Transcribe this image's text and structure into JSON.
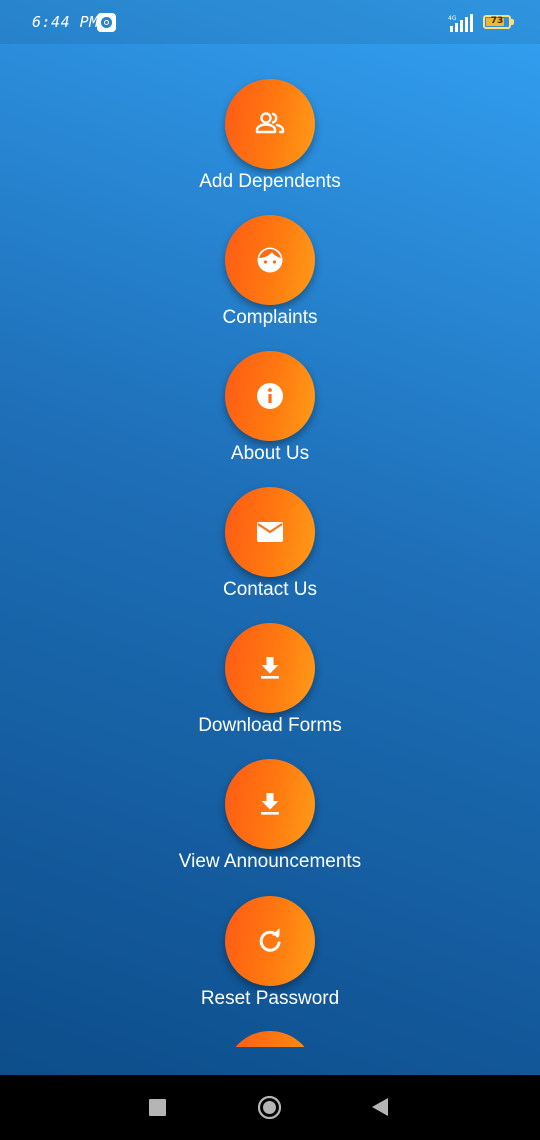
{
  "status_bar": {
    "time": "6:44 PM",
    "battery_level": "73",
    "network_label": "4G",
    "icons": [
      "screen-record-icon",
      "signal-icon",
      "battery-icon"
    ]
  },
  "menu": {
    "items": [
      {
        "label": "Add Dependents",
        "icon": "people-icon"
      },
      {
        "label": "Complaints",
        "icon": "face-icon"
      },
      {
        "label": "About Us",
        "icon": "info-icon"
      },
      {
        "label": "Contact Us",
        "icon": "mail-icon"
      },
      {
        "label": "Download Forms",
        "icon": "download-icon"
      },
      {
        "label": "View Announcements",
        "icon": "download-icon"
      },
      {
        "label": "Reset Password",
        "icon": "refresh-icon"
      }
    ]
  },
  "nav_bar": {
    "buttons": [
      "recents-icon",
      "home-icon",
      "back-icon"
    ]
  },
  "colors": {
    "background_top": "#33a1f2",
    "background_bottom": "#0b4a86",
    "button_orange_start": "#ff5a14",
    "button_orange_end": "#ff9c18",
    "label_text": "#ffffff"
  }
}
